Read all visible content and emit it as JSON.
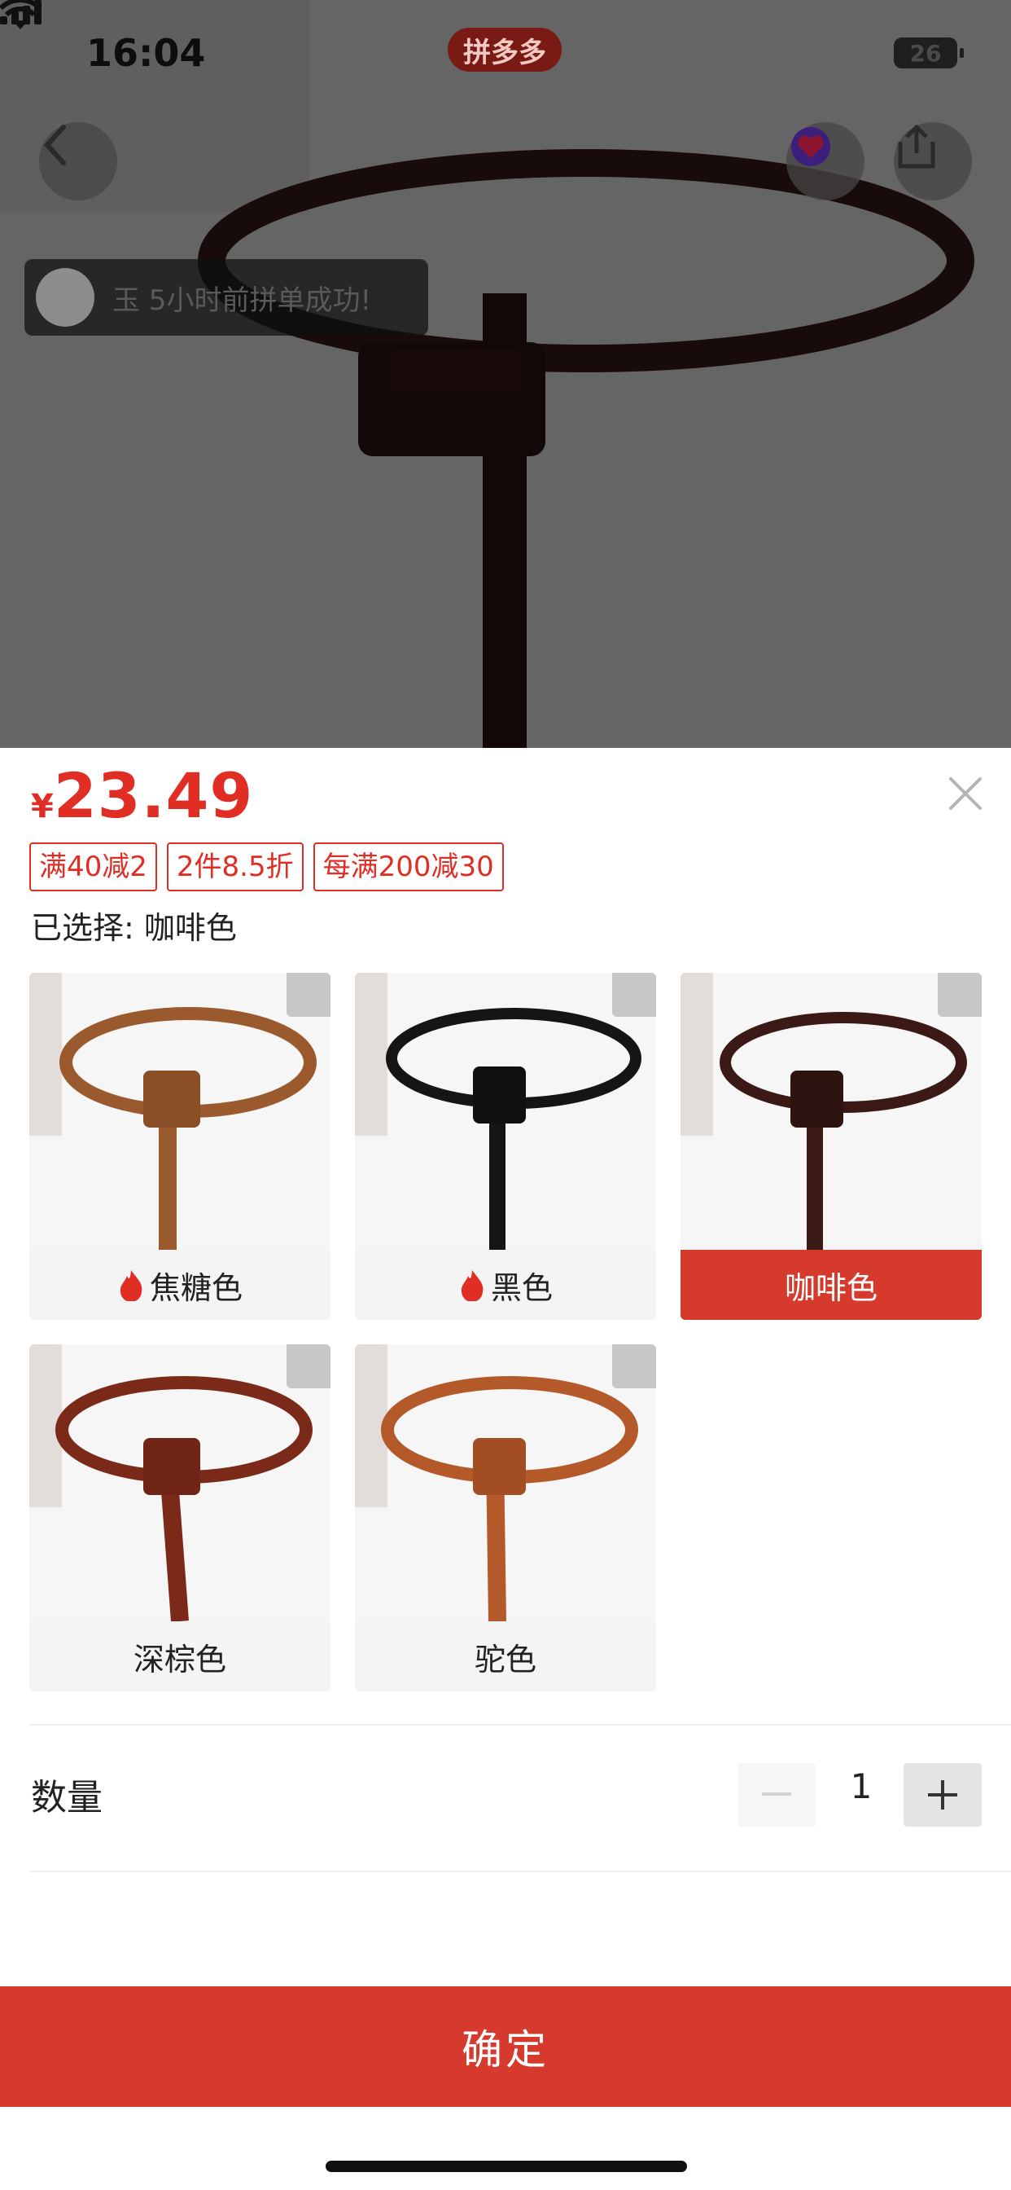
{
  "status_bar": {
    "time": "16:04",
    "app_badge": "拼多多",
    "battery": "26"
  },
  "hero": {
    "toast_text": "玉 5小时前拼单成功!"
  },
  "sheet": {
    "price_currency": "¥",
    "price_value": "23.49",
    "promo_tags": [
      "满40减2",
      "2件8.5折",
      "每满200减30"
    ],
    "selected_text": "已选择: 咖啡色",
    "options": [
      {
        "label": "焦糖色",
        "hot": true,
        "selected": false,
        "color": "#9a5a2e"
      },
      {
        "label": "黑色",
        "hot": true,
        "selected": false,
        "color": "#151515"
      },
      {
        "label": "咖啡色",
        "hot": false,
        "selected": true,
        "color": "#3b1a16"
      },
      {
        "label": "深棕色",
        "hot": false,
        "selected": false,
        "color": "#7b2a1a"
      },
      {
        "label": "驼色",
        "hot": false,
        "selected": false,
        "color": "#b4592a"
      }
    ],
    "quantity_label": "数量",
    "quantity_value": "1",
    "confirm_label": "确定"
  },
  "colors": {
    "accent": "#e02e24",
    "button_red": "#d63a2d"
  }
}
